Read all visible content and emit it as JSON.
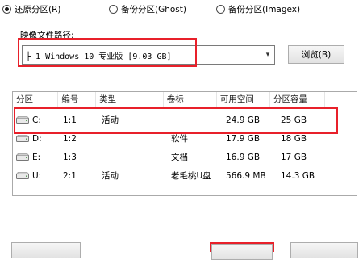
{
  "mode_options": [
    {
      "label": "还原分区(R)",
      "checked": true
    },
    {
      "label": "备份分区(Ghost)",
      "checked": false
    },
    {
      "label": "备份分区(Imagex)",
      "checked": false
    }
  ],
  "image_section": {
    "label": "映像文件路径:",
    "selected_value": "├ 1 Windows 10 专业版 [9.03 GB]",
    "browse_label": "浏览(B)"
  },
  "table": {
    "columns": [
      "分区",
      "编号",
      "类型",
      "卷标",
      "可用空间",
      "分区容量"
    ],
    "rows": [
      {
        "drive": "C:",
        "number": "1:1",
        "type": "活动",
        "label": "",
        "free": "24.9 GB",
        "capacity": "25 GB"
      },
      {
        "drive": "D:",
        "number": "1:2",
        "type": "",
        "label": "软件",
        "free": "17.9 GB",
        "capacity": "18 GB"
      },
      {
        "drive": "E:",
        "number": "1:3",
        "type": "",
        "label": "文档",
        "free": "16.9 GB",
        "capacity": "17 GB"
      },
      {
        "drive": "U:",
        "number": "2:1",
        "type": "活动",
        "label": "老毛桃U盘",
        "free": "566.9 MB",
        "capacity": "14.3 GB"
      }
    ]
  },
  "colors": {
    "highlight": "#e8202a"
  }
}
